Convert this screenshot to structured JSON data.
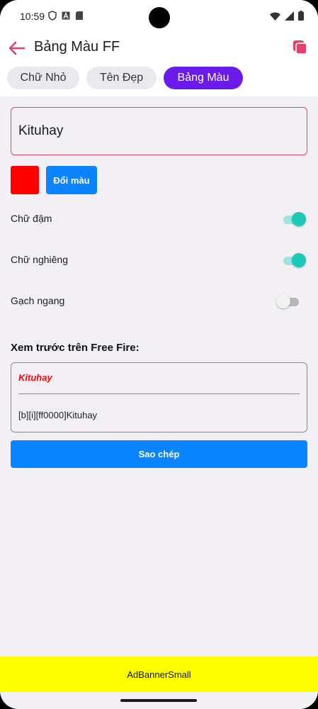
{
  "status_bar": {
    "time": "10:59",
    "left_icons": [
      "shield-icon",
      "a-box-icon",
      "sd-card-icon"
    ],
    "right_icons": [
      "wifi-icon",
      "signal-icon",
      "battery-icon"
    ]
  },
  "app_bar": {
    "title": "Bảng Màu FF",
    "back_icon": "arrow-left-icon",
    "action_icon": "copy-icon",
    "accent_color": "#e2416a"
  },
  "tabs": [
    {
      "label": "Chữ Nhỏ",
      "active": false
    },
    {
      "label": "Tên Đẹp",
      "active": false
    },
    {
      "label": "Bảng Màu",
      "active": true
    }
  ],
  "editor": {
    "input_value": "Kituhay",
    "selected_color": "#ff0000",
    "change_color_label": "Đổi màu"
  },
  "options": [
    {
      "label": "Chữ đậm",
      "enabled": true
    },
    {
      "label": "Chữ nghiêng",
      "enabled": true
    },
    {
      "label": "Gạch ngang",
      "enabled": false
    }
  ],
  "preview": {
    "heading": "Xem trước trên Free Fire:",
    "styled_text": "Kituhay",
    "code": "[b][i][ff0000]Kituhay"
  },
  "copy_button": {
    "label": "Sao chép"
  },
  "ad_banner": {
    "label": "AdBannerSmall"
  },
  "colors": {
    "primary_button": "#0a84ff",
    "active_tab": "#6a1bea",
    "switch_on": "#1ac9b6",
    "ad_background": "#ffff00"
  }
}
